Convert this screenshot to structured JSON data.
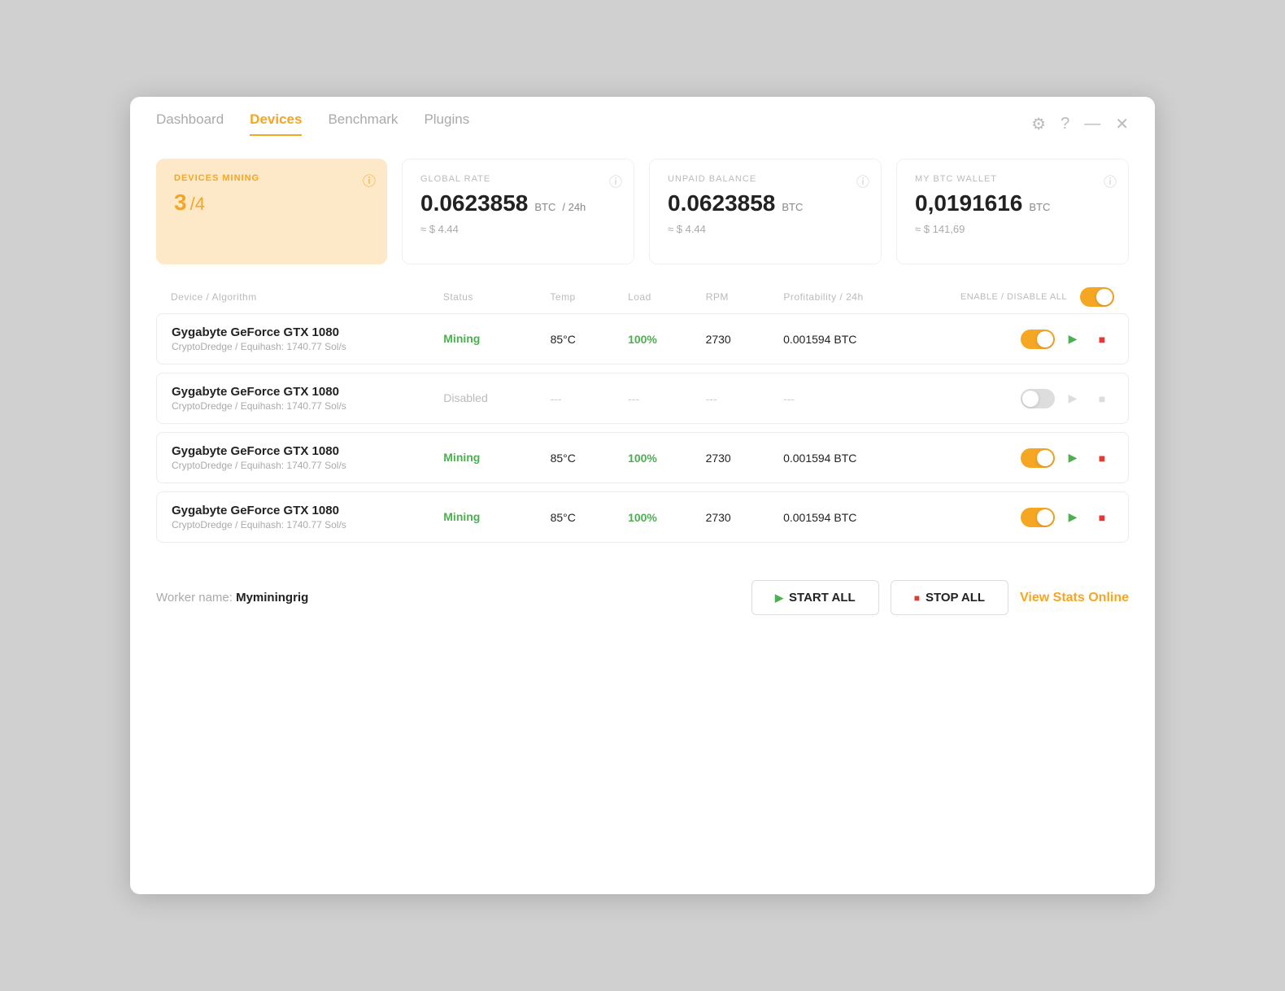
{
  "nav": {
    "tabs": [
      {
        "label": "Dashboard",
        "active": false
      },
      {
        "label": "Devices",
        "active": true
      },
      {
        "label": "Benchmark",
        "active": false
      },
      {
        "label": "Plugins",
        "active": false
      }
    ]
  },
  "stats": {
    "devices_mining": {
      "label": "DEVICES MINING",
      "count": "3",
      "total": "/4"
    },
    "global_rate": {
      "label": "GLOBAL RATE",
      "value": "0.0623858",
      "unit": "BTC",
      "per": "/ 24h",
      "usd": "≈ $ 4.44"
    },
    "unpaid_balance": {
      "label": "UNPAID BALANCE",
      "value": "0.0623858",
      "unit": "BTC",
      "usd": "≈ $ 4.44"
    },
    "btc_wallet": {
      "label": "MY BTC WALLET",
      "value": "0,0191616",
      "unit": "BTC",
      "usd": "≈ $ 141,69"
    }
  },
  "table": {
    "headers": {
      "device": "Device / Algorithm",
      "status": "Status",
      "temp": "Temp",
      "load": "Load",
      "rpm": "RPM",
      "profit": "Profitability / 24h",
      "enable_all": "ENABLE / DISABLE ALL"
    },
    "rows": [
      {
        "name": "Gygabyte GeForce GTX 1080",
        "algo": "CryptoDredge / Equihash: 1740.77 Sol/s",
        "status": "Mining",
        "status_type": "mining",
        "temp": "85°C",
        "load": "100%",
        "rpm": "2730",
        "profit": "0.001594 BTC",
        "enabled": true
      },
      {
        "name": "Gygabyte GeForce GTX 1080",
        "algo": "CryptoDredge / Equihash: 1740.77 Sol/s",
        "status": "Disabled",
        "status_type": "disabled",
        "temp": "---",
        "load": "---",
        "rpm": "---",
        "profit": "---",
        "enabled": false
      },
      {
        "name": "Gygabyte GeForce GTX 1080",
        "algo": "CryptoDredge / Equihash: 1740.77 Sol/s",
        "status": "Mining",
        "status_type": "mining",
        "temp": "85°C",
        "load": "100%",
        "rpm": "2730",
        "profit": "0.001594 BTC",
        "enabled": true
      },
      {
        "name": "Gygabyte GeForce GTX 1080",
        "algo": "CryptoDredge / Equihash: 1740.77 Sol/s",
        "status": "Mining",
        "status_type": "mining",
        "temp": "85°C",
        "load": "100%",
        "rpm": "2730",
        "profit": "0.001594 BTC",
        "enabled": true
      }
    ]
  },
  "footer": {
    "worker_label": "Worker name:",
    "worker_name": "Myminingrig",
    "start_all": "START ALL",
    "stop_all": "STOP ALL",
    "view_stats": "View Stats Online"
  }
}
